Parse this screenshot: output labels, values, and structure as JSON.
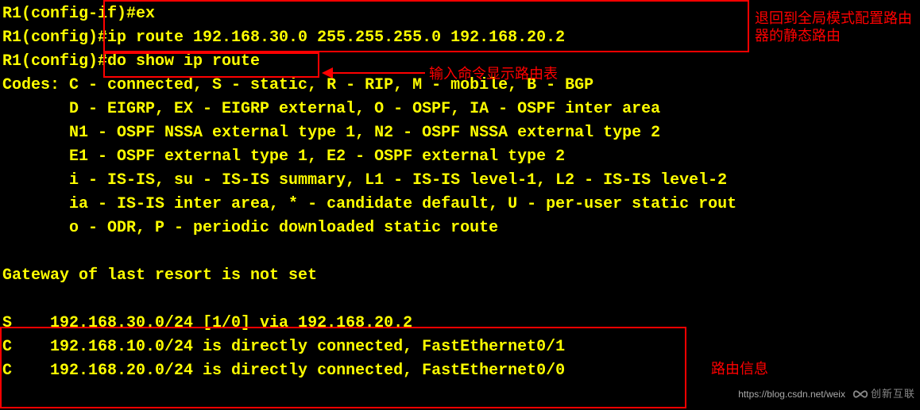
{
  "terminal": {
    "lines": [
      "R1(config-if)#ex",
      "R1(config)#ip route 192.168.30.0 255.255.255.0 192.168.20.2",
      "R1(config)#do show ip route",
      "Codes: C - connected, S - static, R - RIP, M - mobile, B - BGP",
      "       D - EIGRP, EX - EIGRP external, O - OSPF, IA - OSPF inter area",
      "       N1 - OSPF NSSA external type 1, N2 - OSPF NSSA external type 2",
      "       E1 - OSPF external type 1, E2 - OSPF external type 2",
      "       i - IS-IS, su - IS-IS summary, L1 - IS-IS level-1, L2 - IS-IS level-2",
      "       ia - IS-IS inter area, * - candidate default, U - per-user static rout",
      "       o - ODR, P - periodic downloaded static route",
      "",
      "Gateway of last resort is not set",
      "",
      "S    192.168.30.0/24 [1/0] via 192.168.20.2",
      "C    192.168.10.0/24 is directly connected, FastEthernet0/1",
      "C    192.168.20.0/24 is directly connected, FastEthernet0/0"
    ]
  },
  "annotations": {
    "box1_label": "退回到全局模式配置路由器的静态路由",
    "box2_label": "输入命令显示路由表",
    "box3_label": "路由信息"
  },
  "watermark": {
    "url": "https://blog.csdn.net/weix",
    "brand": "创新互联"
  }
}
